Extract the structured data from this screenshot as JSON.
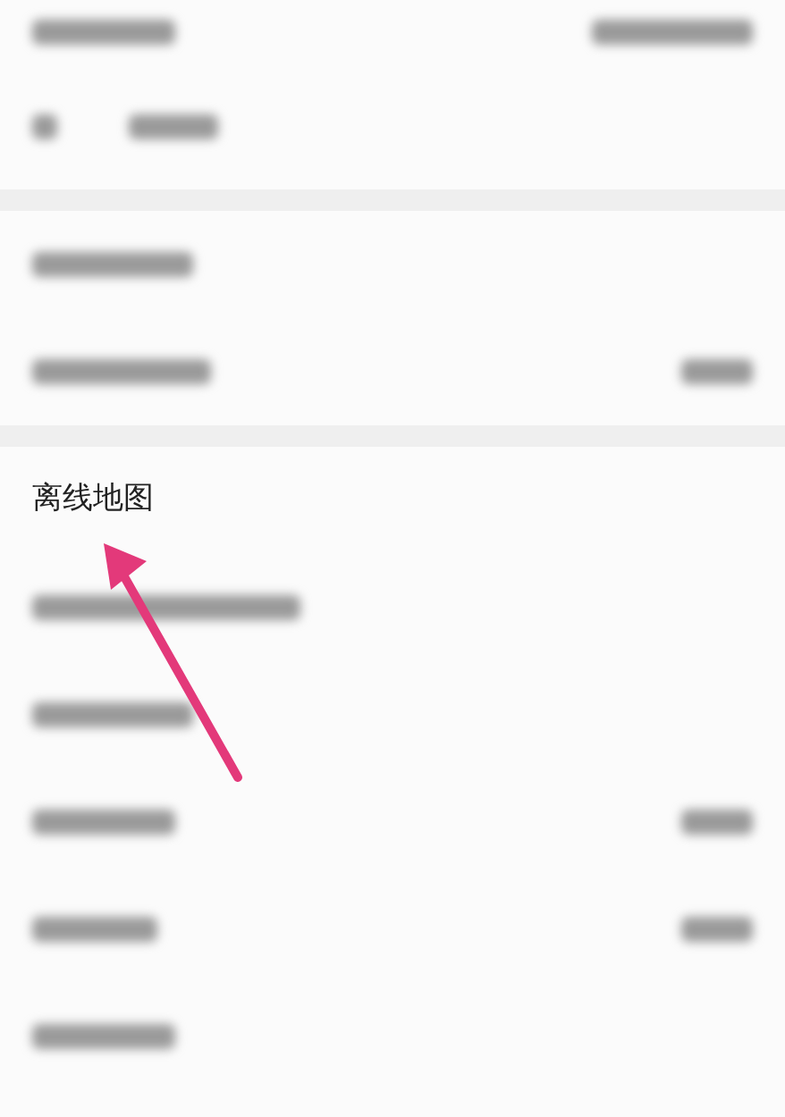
{
  "status_bar": {
    "kind": "blurred"
  },
  "header": {
    "kind": "blurred"
  },
  "sections": [
    [
      {
        "kind": "blurred",
        "value": false
      },
      {
        "kind": "blurred",
        "value": true
      }
    ],
    [
      {
        "kind": "text",
        "label": "离线地图",
        "value": false
      },
      {
        "kind": "blurred",
        "value": false
      },
      {
        "kind": "blurred",
        "value": false
      },
      {
        "kind": "blurred",
        "value": true
      },
      {
        "kind": "blurred",
        "value": true
      },
      {
        "kind": "blurred",
        "value": false
      }
    ]
  ],
  "annotation": {
    "kind": "arrow"
  }
}
